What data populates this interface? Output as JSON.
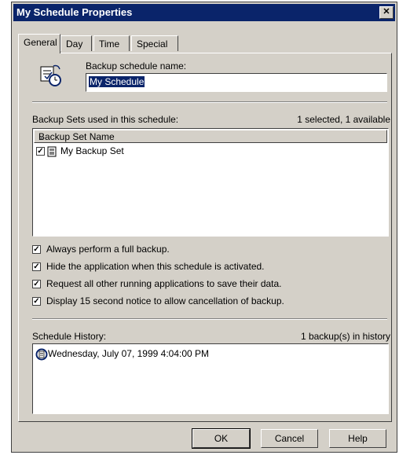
{
  "window": {
    "title": "My Schedule Properties",
    "close_glyph": "✕"
  },
  "tabs": [
    {
      "label": "General",
      "active": true
    },
    {
      "label": "Day",
      "active": false
    },
    {
      "label": "Time",
      "active": false
    },
    {
      "label": "Special",
      "active": false
    }
  ],
  "general": {
    "name_label": "Backup schedule name:",
    "name_value": "My Schedule",
    "sets_label": "Backup Sets used in this schedule:",
    "sets_status": "1 selected, 1 available",
    "sets_column": "Backup Set Name",
    "sets_items": [
      {
        "name": "My Backup Set",
        "checked": true,
        "icon": "backup-set-icon"
      }
    ],
    "options": [
      {
        "label": "Always perform a full backup.",
        "checked": true
      },
      {
        "label": "Hide the application when this schedule is activated.",
        "checked": true
      },
      {
        "label": "Request all other running applications to save their data.",
        "checked": true
      },
      {
        "label": "Display 15 second notice to allow cancellation of backup.",
        "checked": true
      }
    ],
    "history_label": "Schedule History:",
    "history_status": "1 backup(s) in history",
    "history_items": [
      {
        "text": "Wednesday, July 07, 1999 4:04:00 PM",
        "icon": "history-entry-icon"
      }
    ]
  },
  "buttons": {
    "ok": "OK",
    "cancel": "Cancel",
    "help": "Help"
  }
}
